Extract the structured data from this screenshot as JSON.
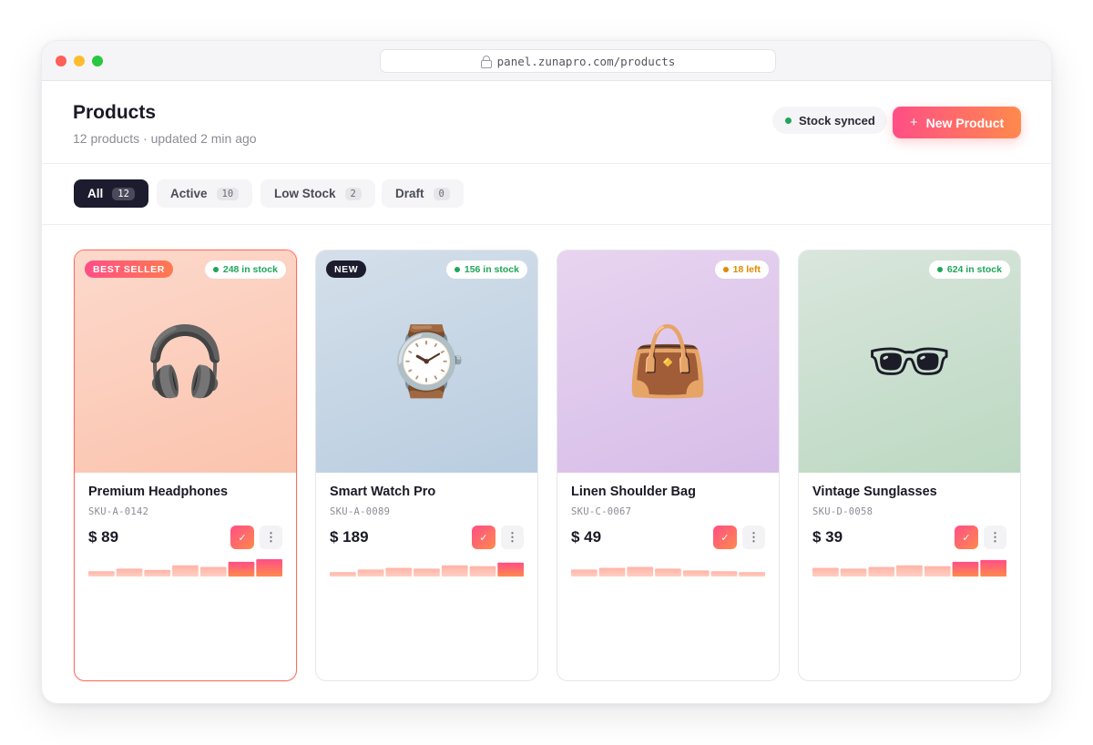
{
  "browser": {
    "url": "panel.zunapro.com/products"
  },
  "header": {
    "title": "Products",
    "subtitle": "12 products · updated 2 min ago",
    "sync_status": "Stock synced",
    "new_button": "New Product",
    "new_button_icon": "+"
  },
  "filters": [
    {
      "label": "All",
      "count": "12",
      "active": true
    },
    {
      "label": "Active",
      "count": "10",
      "active": false
    },
    {
      "label": "Low Stock",
      "count": "2",
      "active": false
    },
    {
      "label": "Draft",
      "count": "0",
      "active": false
    }
  ],
  "products": [
    {
      "name": "Premium Headphones",
      "sku": "SKU-A-0142",
      "price": "$ 89",
      "badge": "BEST SELLER",
      "stock": "248 in stock",
      "stock_color": "#1fa65a",
      "icon": "🎧",
      "icon_name": "headphones-icon",
      "bg_from": "#fcd9cc",
      "bg_to": "#fbc3ad",
      "sales_trend": [
        0.3,
        0.45,
        0.38,
        0.65,
        0.55,
        0.85,
        1.0
      ]
    },
    {
      "name": "Smart Watch Pro",
      "sku": "SKU-A-0089",
      "price": "$ 189",
      "badge": "NEW",
      "stock": "156 in stock",
      "stock_color": "#1fa65a",
      "icon": "⌚",
      "icon_name": "watch-icon",
      "bg_from": "#d4dfea",
      "bg_to": "#b9cde0",
      "sales_trend": [
        0.25,
        0.4,
        0.5,
        0.45,
        0.65,
        0.6,
        0.8
      ]
    },
    {
      "name": "Linen Shoulder Bag",
      "sku": "SKU-C-0067",
      "price": "$ 49",
      "badge": "",
      "stock": "18 left",
      "stock_color": "#e08a00",
      "icon": "👜",
      "icon_name": "handbag-icon",
      "bg_from": "#e8d4f0",
      "bg_to": "#d6bde8",
      "sales_trend": [
        0.4,
        0.5,
        0.55,
        0.45,
        0.35,
        0.3,
        0.25
      ]
    },
    {
      "name": "Vintage Sunglasses",
      "sku": "SKU-D-0058",
      "price": "$ 39",
      "badge": "",
      "stock": "624 in stock",
      "stock_color": "#1fa65a",
      "icon": "🕶",
      "icon_name": "sunglasses-icon",
      "bg_from": "#d9e6dc",
      "bg_to": "#bcd8c2",
      "sales_trend": [
        0.5,
        0.45,
        0.55,
        0.65,
        0.6,
        0.85,
        0.95
      ]
    }
  ],
  "colors": {
    "accent_from": "#ff4e86",
    "accent_to": "#ff8a4c",
    "dark": "#1c1c2e",
    "success": "#1fa65a",
    "warning": "#e08a00"
  }
}
